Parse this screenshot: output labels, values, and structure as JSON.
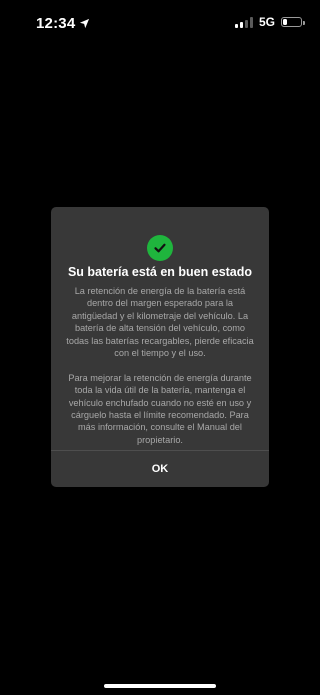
{
  "status_bar": {
    "time": "12:34",
    "network": "5G",
    "signal_bars_active": 2,
    "signal_bars_total": 4,
    "battery_level": 0.25,
    "icons": [
      "location-arrow-icon",
      "signal-bars-icon",
      "battery-icon"
    ]
  },
  "dialog": {
    "icon": "check-circle-icon",
    "icon_color": "#1fb53d",
    "title": "Su batería está en buen estado",
    "paragraph_1": "La retención de energía de la batería está dentro del margen esperado para la antigüedad y el kilometraje del vehículo. La batería de alta tensión del vehículo, como todas las baterías recargables, pierde eficacia con el tiempo y el uso.",
    "paragraph_2": "Para mejorar la retención de energía durante toda la vida útil de la batería, mantenga el vehículo enchufado cuando no esté en uso y cárguelo hasta el límite recomendado. Para más información, consulte el Manual del propietario.",
    "ok_label": "OK"
  },
  "colors": {
    "background": "#000000",
    "dialog_background": "#383838",
    "body_text": "#a8a8a8",
    "accent_green": "#1fb53d"
  }
}
